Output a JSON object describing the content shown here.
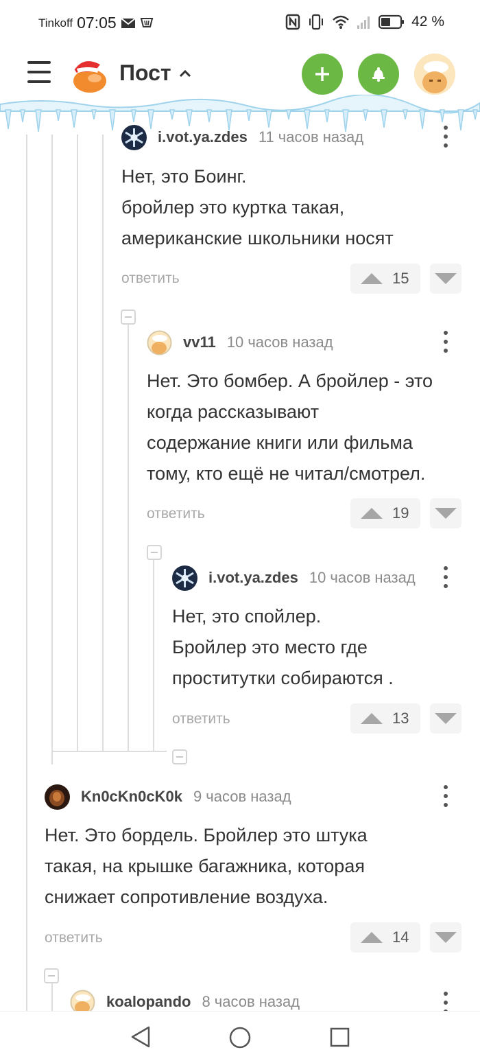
{
  "status_bar": {
    "carrier": "Tinkoff",
    "time": "07:05",
    "battery": "42 %",
    "icons": [
      "mail-icon",
      "sim-icon",
      "nfc-icon",
      "vibrate-icon",
      "wifi-icon",
      "signal-icon",
      "battery-icon"
    ]
  },
  "header": {
    "title": "Пост",
    "icons": [
      "menu-icon",
      "santa-logo-icon",
      "chevron-up-icon",
      "plus-icon",
      "bell-icon",
      "user-avatar-icon"
    ],
    "accent_color": "#6bb844"
  },
  "comments": [
    {
      "user": "i.vot.ya.zdes",
      "time": "11 часов назад",
      "body": "Нет, это Боинг.\nбройлер это куртка такая,\nамериканские школьники носят",
      "reply": "ответить",
      "votes": "15"
    },
    {
      "user": "vv11",
      "time": "10 часов назад",
      "body": "Нет. Это бомбер. А бройлер - это\nкогда рассказывают\nсодержание книги или фильма\nтому, кто ещё не читал/смотрел.",
      "reply": "ответить",
      "votes": "19"
    },
    {
      "user": "i.vot.ya.zdes",
      "time": "10 часов назад",
      "body": "Нет, это спойлер.\nБройлер это место где\nпроститутки собираются .",
      "reply": "ответить",
      "votes": "13"
    },
    {
      "user": "Kn0cKn0cK0k",
      "time": "9 часов назад",
      "body": "Нет. Это бордель. Бройлер это штука\nтакая, на крышке багажника, которая\nснижает сопротивление воздуха.",
      "reply": "ответить",
      "votes": "14"
    },
    {
      "user": "koalopando",
      "time": "8 часов назад"
    }
  ],
  "nav": {
    "icons": [
      "back-icon",
      "home-icon",
      "recents-icon"
    ]
  }
}
